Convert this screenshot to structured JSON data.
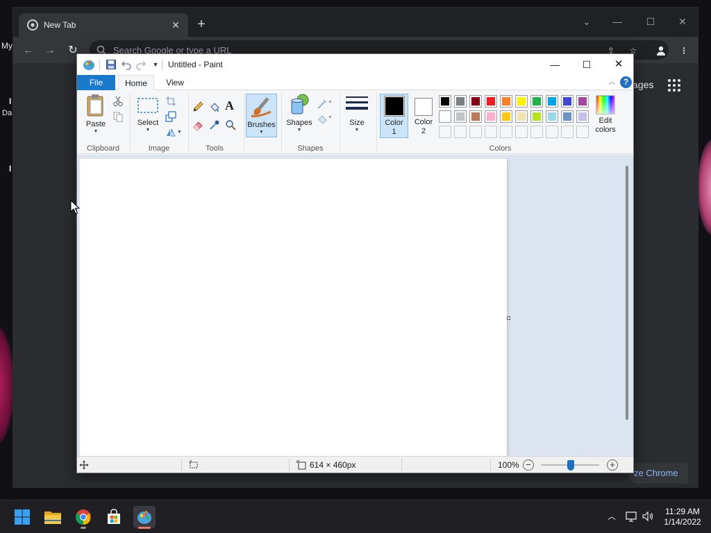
{
  "desktop": {
    "partial_labels": [
      "My",
      "Da",
      "I",
      "I"
    ]
  },
  "chrome": {
    "tab_title": "New Tab",
    "omnibox_placeholder": "Search Google or type a URL",
    "images_link": "ages",
    "customize_label": "ze Chrome"
  },
  "paint": {
    "window_title": "Untitled - Paint",
    "tabs": {
      "file": "File",
      "home": "Home",
      "view": "View"
    },
    "help": "?",
    "clipboard": {
      "paste": "Paste",
      "group": "Clipboard"
    },
    "image": {
      "select": "Select",
      "group": "Image"
    },
    "tools": {
      "group": "Tools",
      "text_tool": "A"
    },
    "brushes": {
      "label": "Brushes"
    },
    "shapes": {
      "label": "Shapes",
      "group": "Shapes"
    },
    "size": {
      "label": "Size"
    },
    "colors": {
      "color1_line1": "Color",
      "color1_line2": "1",
      "color2_line1": "Color",
      "color2_line2": "2",
      "edit_line1": "Edit",
      "edit_line2": "colors",
      "group": "Colors",
      "color1_value": "#000000",
      "color2_value": "#ffffff",
      "palette_row1": [
        "#000000",
        "#7f7f7f",
        "#880015",
        "#ed1c24",
        "#ff7f27",
        "#fff200",
        "#22b14c",
        "#00a2e8",
        "#3f48cc",
        "#a349a4"
      ],
      "palette_row2": [
        "#ffffff",
        "#c3c3c3",
        "#b97a57",
        "#ffaec9",
        "#ffc90e",
        "#efe4b0",
        "#b5e61d",
        "#99d9ea",
        "#7092be",
        "#c8bfe7"
      ],
      "palette_row3": [
        "#f5f6f7",
        "#f5f6f7",
        "#f5f6f7",
        "#f5f6f7",
        "#f5f6f7",
        "#f5f6f7",
        "#f5f6f7",
        "#f5f6f7",
        "#f5f6f7",
        "#f5f6f7"
      ]
    },
    "status": {
      "dimensions": "614 × 460px",
      "zoom": "100%",
      "zoom_minus": "−",
      "zoom_plus": "+"
    }
  },
  "taskbar": {
    "time": "11:29 AM",
    "date": "1/14/2022"
  }
}
